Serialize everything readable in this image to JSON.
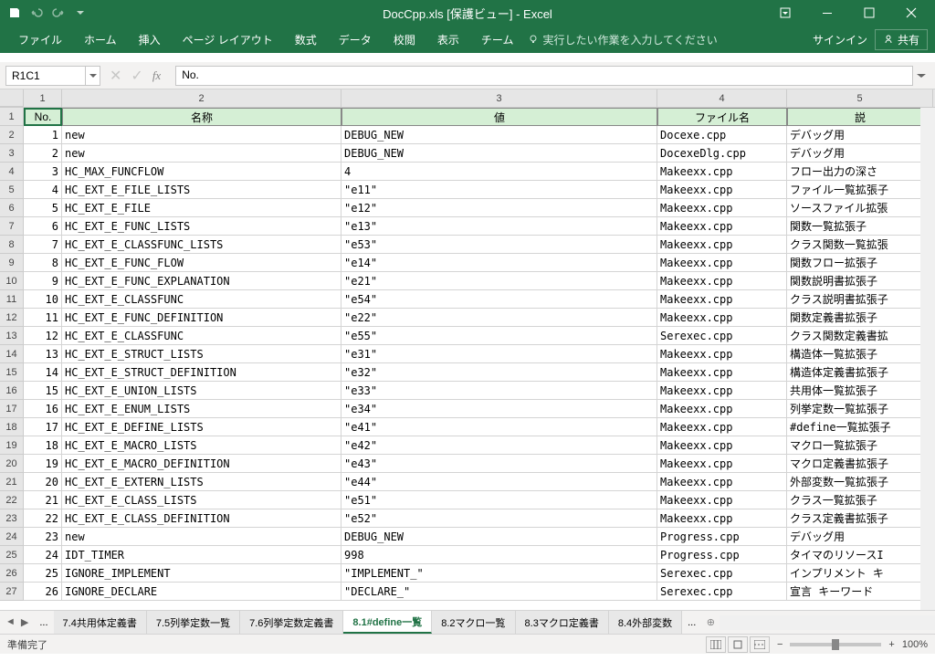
{
  "title": "DocCpp.xls [保護ビュー] - Excel",
  "ribbon": {
    "tabs": [
      "ファイル",
      "ホーム",
      "挿入",
      "ページ レイアウト",
      "数式",
      "データ",
      "校閲",
      "表示",
      "チーム"
    ],
    "tellme": "実行したい作業を入力してください",
    "signin": "サインイン",
    "share": "共有"
  },
  "namebox": "R1C1",
  "formula": "No.",
  "columns": [
    "1",
    "2",
    "3",
    "4",
    "5"
  ],
  "headers": [
    "No.",
    "名称",
    "値",
    "ファイル名",
    "説"
  ],
  "rows": [
    {
      "r": "1"
    },
    {
      "r": "2",
      "no": "1",
      "name": "new",
      "val": "DEBUG_NEW",
      "file": "Docexe.cpp",
      "desc": "デバッグ用"
    },
    {
      "r": "3",
      "no": "2",
      "name": "new",
      "val": "DEBUG_NEW",
      "file": "DocexeDlg.cpp",
      "desc": "デバッグ用"
    },
    {
      "r": "4",
      "no": "3",
      "name": "HC_MAX_FUNCFLOW",
      "val": "4",
      "file": "Makeexx.cpp",
      "desc": "フロー出力の深さ"
    },
    {
      "r": "5",
      "no": "4",
      "name": "HC_EXT_E_FILE_LISTS",
      "val": "\"e11\"",
      "file": "Makeexx.cpp",
      "desc": "ファイル一覧拡張子"
    },
    {
      "r": "6",
      "no": "5",
      "name": "HC_EXT_E_FILE",
      "val": "\"e12\"",
      "file": "Makeexx.cpp",
      "desc": "ソースファイル拡張"
    },
    {
      "r": "7",
      "no": "6",
      "name": "HC_EXT_E_FUNC_LISTS",
      "val": "\"e13\"",
      "file": "Makeexx.cpp",
      "desc": "関数一覧拡張子"
    },
    {
      "r": "8",
      "no": "7",
      "name": "HC_EXT_E_CLASSFUNC_LISTS",
      "val": "\"e53\"",
      "file": "Makeexx.cpp",
      "desc": "クラス関数一覧拡張"
    },
    {
      "r": "9",
      "no": "8",
      "name": "HC_EXT_E_FUNC_FLOW",
      "val": "\"e14\"",
      "file": "Makeexx.cpp",
      "desc": "関数フロー拡張子"
    },
    {
      "r": "10",
      "no": "9",
      "name": "HC_EXT_E_FUNC_EXPLANATION",
      "val": "\"e21\"",
      "file": "Makeexx.cpp",
      "desc": "関数説明書拡張子"
    },
    {
      "r": "11",
      "no": "10",
      "name": "HC_EXT_E_CLASSFUNC",
      "val": "\"e54\"",
      "file": "Makeexx.cpp",
      "desc": "クラス説明書拡張子"
    },
    {
      "r": "12",
      "no": "11",
      "name": "HC_EXT_E_FUNC_DEFINITION",
      "val": "\"e22\"",
      "file": "Makeexx.cpp",
      "desc": "関数定義書拡張子"
    },
    {
      "r": "13",
      "no": "12",
      "name": "HC_EXT_E_CLASSFUNC",
      "val": "\"e55\"",
      "file": "Serexec.cpp",
      "desc": "クラス関数定義書拡"
    },
    {
      "r": "14",
      "no": "13",
      "name": "HC_EXT_E_STRUCT_LISTS",
      "val": "\"e31\"",
      "file": "Makeexx.cpp",
      "desc": "構造体一覧拡張子"
    },
    {
      "r": "15",
      "no": "14",
      "name": "HC_EXT_E_STRUCT_DEFINITION",
      "val": "\"e32\"",
      "file": "Makeexx.cpp",
      "desc": "構造体定義書拡張子"
    },
    {
      "r": "16",
      "no": "15",
      "name": "HC_EXT_E_UNION_LISTS",
      "val": "\"e33\"",
      "file": "Makeexx.cpp",
      "desc": "共用体一覧拡張子"
    },
    {
      "r": "17",
      "no": "16",
      "name": "HC_EXT_E_ENUM_LISTS",
      "val": "\"e34\"",
      "file": "Makeexx.cpp",
      "desc": "列挙定数一覧拡張子"
    },
    {
      "r": "18",
      "no": "17",
      "name": "HC_EXT_E_DEFINE_LISTS",
      "val": "\"e41\"",
      "file": "Makeexx.cpp",
      "desc": "#define一覧拡張子"
    },
    {
      "r": "19",
      "no": "18",
      "name": "HC_EXT_E_MACRO_LISTS",
      "val": "\"e42\"",
      "file": "Makeexx.cpp",
      "desc": "マクロ一覧拡張子"
    },
    {
      "r": "20",
      "no": "19",
      "name": "HC_EXT_E_MACRO_DEFINITION",
      "val": "\"e43\"",
      "file": "Makeexx.cpp",
      "desc": "マクロ定義書拡張子"
    },
    {
      "r": "21",
      "no": "20",
      "name": "HC_EXT_E_EXTERN_LISTS",
      "val": "\"e44\"",
      "file": "Makeexx.cpp",
      "desc": "外部変数一覧拡張子"
    },
    {
      "r": "22",
      "no": "21",
      "name": "HC_EXT_E_CLASS_LISTS",
      "val": "\"e51\"",
      "file": "Makeexx.cpp",
      "desc": "クラス一覧拡張子"
    },
    {
      "r": "23",
      "no": "22",
      "name": "HC_EXT_E_CLASS_DEFINITION",
      "val": "\"e52\"",
      "file": "Makeexx.cpp",
      "desc": "クラス定義書拡張子"
    },
    {
      "r": "24",
      "no": "23",
      "name": "new",
      "val": "DEBUG_NEW",
      "file": "Progress.cpp",
      "desc": "デバッグ用"
    },
    {
      "r": "25",
      "no": "24",
      "name": "IDT_TIMER",
      "val": "998",
      "file": "Progress.cpp",
      "desc": "タイマのリソースI"
    },
    {
      "r": "26",
      "no": "25",
      "name": "IGNORE_IMPLEMENT",
      "val": "\"IMPLEMENT_\"",
      "file": "Serexec.cpp",
      "desc": "インプリメント キ"
    },
    {
      "r": "27",
      "no": "26",
      "name": "IGNORE_DECLARE",
      "val": "\"DECLARE_\"",
      "file": "Serexec.cpp",
      "desc": "宣言 キーワード"
    }
  ],
  "sheets": {
    "ellipsis": "...",
    "list": [
      "7.4共用体定義書",
      "7.5列挙定数一覧",
      "7.6列挙定数定義書",
      "8.1#define一覧",
      "8.2マクロ一覧",
      "8.3マクロ定義書",
      "8.4外部変数"
    ],
    "activeIndex": 3,
    "trailing": "..."
  },
  "status": {
    "ready": "準備完了",
    "zoom": "100%"
  }
}
